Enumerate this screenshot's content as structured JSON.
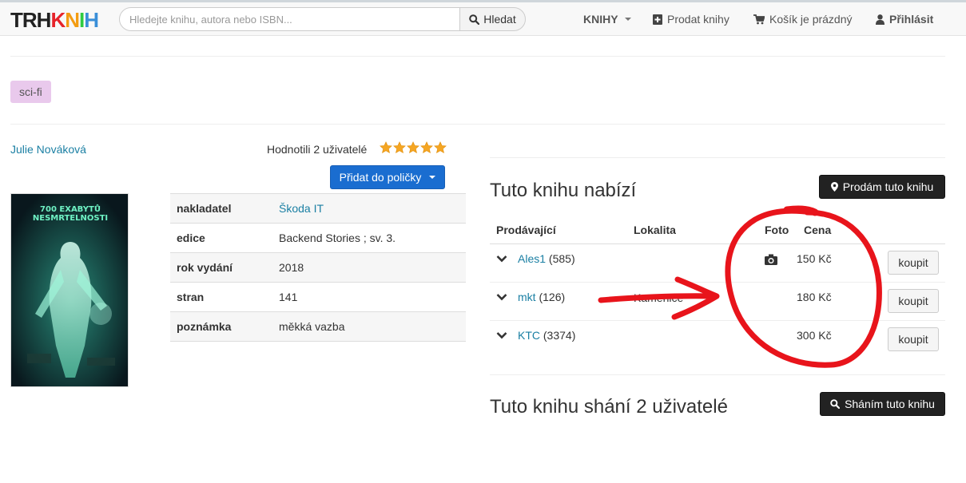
{
  "header": {
    "logo": [
      {
        "letter": "T",
        "color": "#222222"
      },
      {
        "letter": "R",
        "color": "#222222"
      },
      {
        "letter": "H",
        "color": "#222222"
      },
      {
        "letter": "K",
        "color": "#e6242b"
      },
      {
        "letter": "N",
        "color": "#f39c12"
      },
      {
        "letter": "I",
        "color": "#2ecc40"
      },
      {
        "letter": "H",
        "color": "#3a8fd8"
      }
    ],
    "search": {
      "placeholder": "Hledejte knihu, autora nebo ISBN...",
      "button": "Hledat",
      "icon": "search-icon"
    },
    "nav": {
      "books": "KNIHY",
      "sell": "Prodat knihy",
      "cart": "Košík je prázdný",
      "login": "Přihlásit"
    }
  },
  "book": {
    "tag": "sci-fi",
    "author": "Julie Nováková",
    "rated_text": "Hodnotili 2 uživatelé",
    "rating_stars": 5,
    "shelf_button": "Přidat do poličky",
    "cover_alt": "700 EXABYTŮ NESMRTELNOSTI",
    "details": [
      {
        "key": "nakladatel",
        "value": "Škoda IT",
        "link": true
      },
      {
        "key": "edice",
        "value": "Backend Stories ; sv. 3.",
        "link": false
      },
      {
        "key": "rok vydání",
        "value": "2018",
        "link": false
      },
      {
        "key": "stran",
        "value": "141",
        "link": false
      },
      {
        "key": "poznámka",
        "value": "měkká vazba",
        "link": false
      }
    ]
  },
  "offers": {
    "title": "Tuto knihu nabízí",
    "sell_button": "Prodám tuto knihu",
    "columns": {
      "seller": "Prodávající",
      "location": "Lokalita",
      "photo": "Foto",
      "price": "Cena"
    },
    "rows": [
      {
        "seller": "Ales1",
        "count": "(585)",
        "location": "",
        "has_photo": true,
        "price": "150 Kč",
        "buy": "koupit"
      },
      {
        "seller": "mkt",
        "count": "(126)",
        "location": "Kamenice",
        "has_photo": false,
        "price": "180 Kč",
        "buy": "koupit"
      },
      {
        "seller": "KTC",
        "count": "(3374)",
        "location": "",
        "has_photo": false,
        "price": "300 Kč",
        "buy": "koupit"
      }
    ]
  },
  "wanted": {
    "title": "Tuto knihu shání 2 uživatelé",
    "button": "Sháním tuto knihu"
  },
  "colors": {
    "accent": "#1a6dd0",
    "link": "#1a7fa3",
    "tag_bg": "#e9c9ec",
    "star": "#f5a623",
    "annotation": "#e8141b"
  }
}
